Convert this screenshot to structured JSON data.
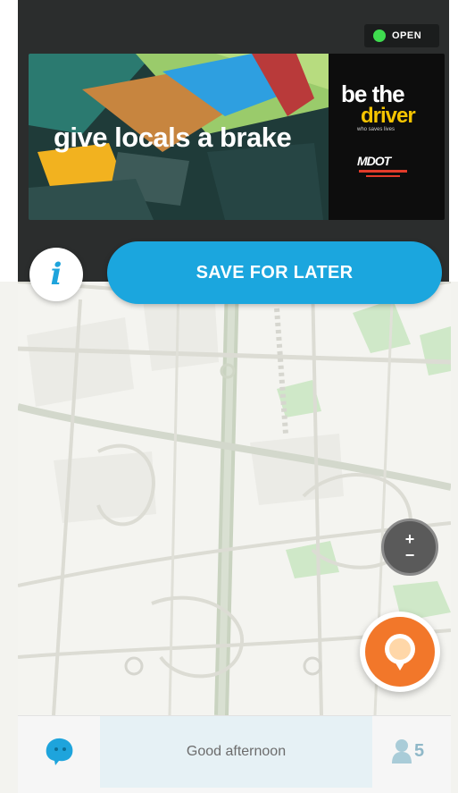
{
  "status": {
    "badge_label": "OPEN",
    "badge_color": "#3fdc4f"
  },
  "banner": {
    "headline": "give locals a brake",
    "brand_line1": "be the",
    "brand_line2": "driver",
    "brand_tagline": "who saves lives",
    "sponsor_logo": "MDOT"
  },
  "actions": {
    "info_icon": "info-icon",
    "save_label": "SAVE FOR LATER",
    "accent_color": "#1ba6de"
  },
  "map_controls": {
    "zoom_in": "+",
    "zoom_out": "−",
    "report_icon": "report-bubble-icon",
    "report_color": "#f2772a"
  },
  "bottom_bar": {
    "menu_icon": "wazer-icon",
    "greeting": "Good afternoon",
    "friends_icon": "person-icon",
    "friends_count": "5"
  }
}
